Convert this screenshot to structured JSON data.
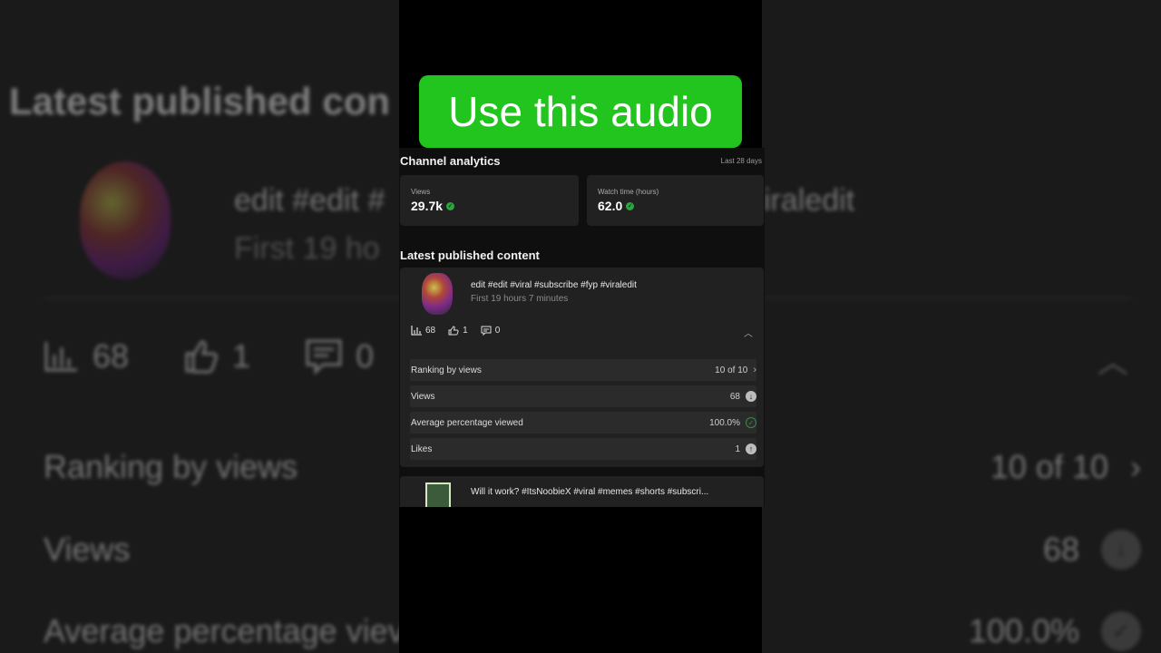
{
  "cta": {
    "label": "Use this audio"
  },
  "background": {
    "title": "Latest published con",
    "video_title_left": "edit #edit #",
    "video_title_right": "iraledit",
    "video_subtitle": "First 19 ho",
    "views_count": "68",
    "likes_count": "1",
    "comments_count": "0",
    "ranking_label": "Ranking by views",
    "ranking_value": "10 of 10",
    "views_label": "Views",
    "views_value": "68",
    "avg_label": "Average percentage viev",
    "avg_value": "100.0%"
  },
  "analytics": {
    "heading": "Channel analytics",
    "period": "Last 28 days",
    "views_label": "Views",
    "views_value": "29.7k",
    "watch_label": "Watch time (hours)",
    "watch_value": "62.0"
  },
  "latest": {
    "heading": "Latest published content",
    "video": {
      "title": "edit #edit #viral #subscribe #fyp #viraledit",
      "subtitle": "First 19 hours 7 minutes",
      "views": "68",
      "likes": "1",
      "comments": "0"
    },
    "metrics": [
      {
        "label": "Ranking by views",
        "value": "10 of 10"
      },
      {
        "label": "Views",
        "value": "68"
      },
      {
        "label": "Average percentage viewed",
        "value": "100.0%"
      },
      {
        "label": "Likes",
        "value": "1"
      }
    ],
    "next_video": {
      "title": "Will it work? #ItsNoobieX #viral #memes #shorts #subscri..."
    }
  },
  "colors": {
    "accent_green": "#22c51e",
    "status_green": "#2ba640",
    "card_bg": "#212121"
  }
}
